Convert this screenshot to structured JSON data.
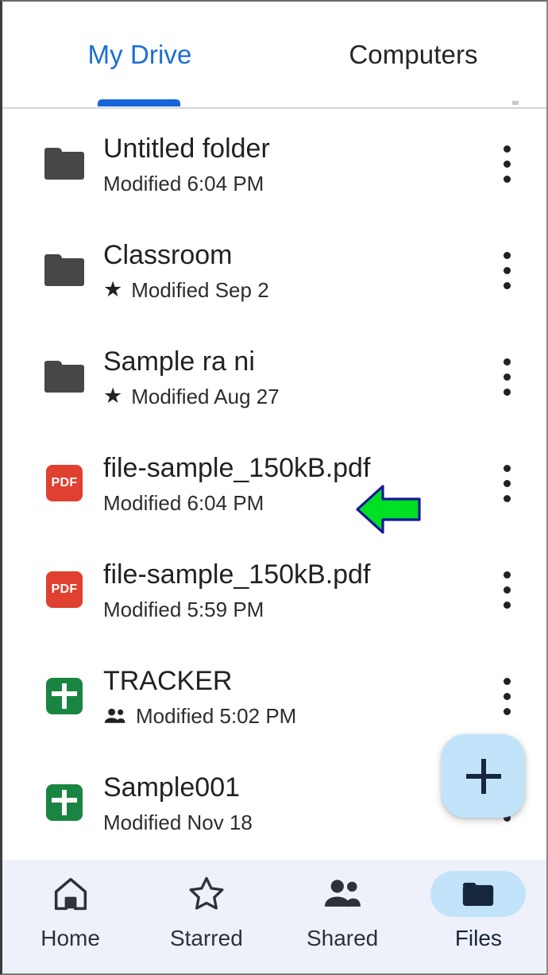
{
  "app": {
    "screen_name": "Google Drive - My Drive file list"
  },
  "tabs": {
    "items": [
      {
        "label": "My Drive",
        "active": true
      },
      {
        "label": "Computers",
        "active": false
      }
    ],
    "active_color": "#1a6ed8",
    "indicator_color": "#1665d8"
  },
  "files": {
    "rows": [
      {
        "name": "Untitled folder",
        "subtitle": "Modified 6:04 PM",
        "icon": "folder-icon",
        "starred": false,
        "shared": false,
        "overflow": "more-options-icon"
      },
      {
        "name": "Classroom",
        "subtitle": "Modified Sep 2",
        "icon": "folder-icon",
        "starred": true,
        "star_glyph": "★",
        "shared": false,
        "overflow": "more-options-icon"
      },
      {
        "name": "Sample ra ni",
        "subtitle": "Modified Aug 27",
        "icon": "folder-icon",
        "starred": true,
        "star_glyph": "★",
        "shared": false,
        "overflow": "more-options-icon"
      },
      {
        "name": "file-sample_150kB.pdf",
        "subtitle": "Modified 6:04 PM",
        "icon": "pdf-file-icon",
        "icon_label": "PDF",
        "icon_color": "#e04030",
        "starred": false,
        "shared": false,
        "overflow": "more-options-icon",
        "annotated": true
      },
      {
        "name": "file-sample_150kB.pdf",
        "subtitle": "Modified 5:59 PM",
        "icon": "pdf-file-icon",
        "icon_label": "PDF",
        "icon_color": "#e04030",
        "starred": false,
        "shared": false,
        "overflow": "more-options-icon"
      },
      {
        "name": " TRACKER",
        "subtitle": "Modified 5:02 PM",
        "icon": "google-sheets-icon",
        "icon_color": "#1a8442",
        "starred": false,
        "shared": true,
        "overflow": "more-options-icon"
      },
      {
        "name": "Sample001",
        "subtitle": "Modified Nov 18",
        "icon": "google-sheets-icon",
        "icon_color": "#1a8442",
        "starred": false,
        "shared": false,
        "overflow": "more-options-icon"
      }
    ]
  },
  "annotation": {
    "type": "arrow-left",
    "fill": "#00e022",
    "stroke": "#15159c",
    "points_at": "file-sample_150kB.pdf"
  },
  "fab": {
    "label": "+",
    "name": "create-new-button",
    "background": "#c2e4fb",
    "icon_color": "#16263c"
  },
  "bottom_nav": {
    "background": "#eef1f9",
    "items": [
      {
        "label": "Home",
        "icon": "home-icon",
        "active": false
      },
      {
        "label": "Starred",
        "icon": "star-outline-icon",
        "active": false
      },
      {
        "label": "Shared",
        "icon": "people-icon",
        "active": false
      },
      {
        "label": "Files",
        "icon": "folder-filled-icon",
        "active": true
      }
    ]
  }
}
